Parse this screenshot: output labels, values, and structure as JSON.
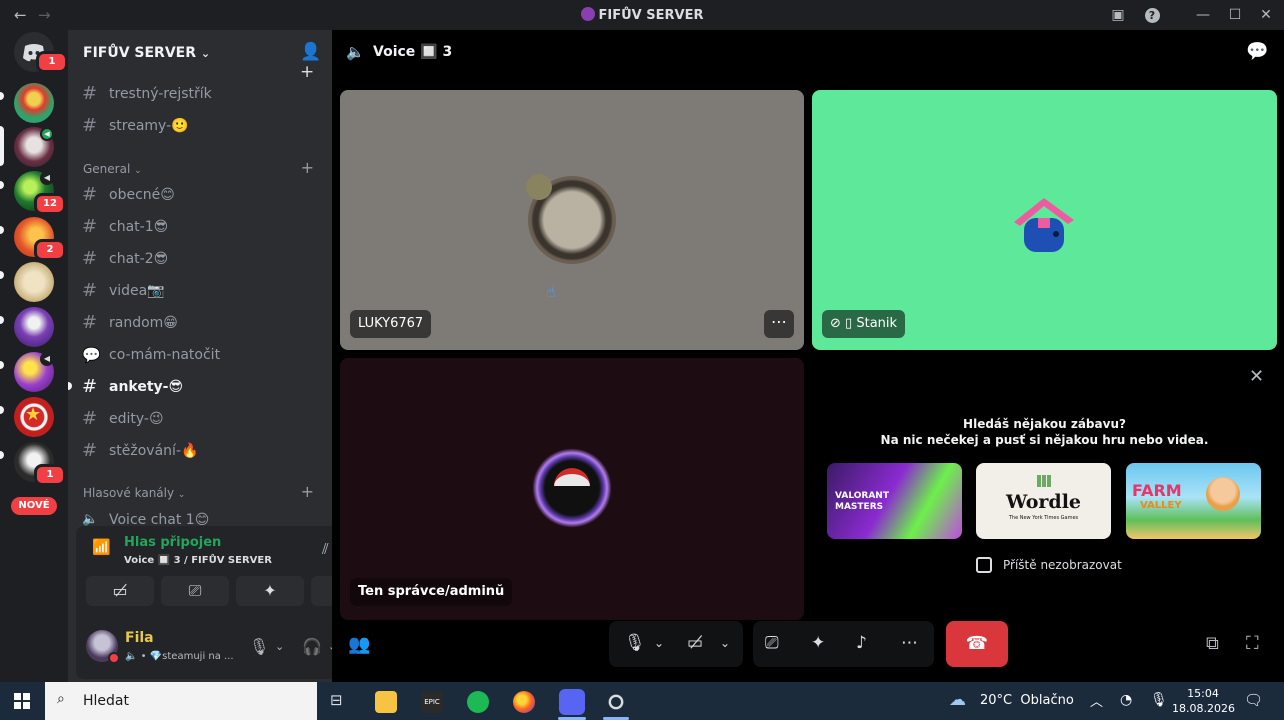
{
  "window": {
    "title": "FIFŮV SERVER",
    "back_icon": "arrow-left-icon",
    "forward_icon": "arrow-right-icon"
  },
  "rail": {
    "home_badge": "1",
    "servers": [
      {
        "name": "server-clown",
        "badge": ""
      },
      {
        "name": "server-fifa",
        "badge": ""
      },
      {
        "name": "server-green",
        "badge": "12"
      },
      {
        "name": "server-orange",
        "badge": "2"
      },
      {
        "name": "server-beige",
        "badge": ""
      },
      {
        "name": "server-purple-girl",
        "badge": ""
      },
      {
        "name": "server-purple-yellow",
        "badge": ""
      },
      {
        "name": "server-red-star",
        "badge": ""
      },
      {
        "name": "server-ace",
        "badge": "1"
      }
    ],
    "new_label": "NOVÉ"
  },
  "sidebar": {
    "server_name": "FIFŮV SERVER",
    "channels_top": [
      {
        "label": "trestný-rejstřík"
      },
      {
        "label": "streamy-🙂"
      }
    ],
    "category_general": "General",
    "channels_general": [
      {
        "label": "obecné😊"
      },
      {
        "label": "chat-1😎"
      },
      {
        "label": "chat-2😎"
      },
      {
        "label": "videa📷"
      },
      {
        "label": "random😁"
      },
      {
        "label": "co-mám-natočit"
      },
      {
        "label": "ankety-😎",
        "active": true
      },
      {
        "label": "edity-😉"
      },
      {
        "label": "stěžování-🔥"
      }
    ],
    "category_voice": "Hlasové kanály",
    "voice_channel": "Voice chat 1😊"
  },
  "voice_panel": {
    "status": "Hlas připojen",
    "channel": "Voice 🔲 3 / FIFŮV SERVER"
  },
  "user_panel": {
    "name": "Fila",
    "status": "💎steamuji na ..."
  },
  "main": {
    "title": "Voice 🔲 3",
    "tiles": [
      {
        "name": "LUKY6767"
      },
      {
        "name": "Stanik"
      },
      {
        "name": "Ten správce/adminŭ"
      }
    ],
    "activity": {
      "line1": "Hledáš nějakou zábavu?",
      "line2": "Na nic nečekej a pusť si nějakou hru nebo videa.",
      "games": [
        {
          "label": "VALORANT MASTERS"
        },
        {
          "label": "Wordle",
          "sub": "The New York Times Games"
        },
        {
          "label": "FARM",
          "sub": "VALLEY"
        }
      ],
      "checkbox_label": "Příště nezobrazovat"
    }
  },
  "taskbar": {
    "search_placeholder": "Hledat",
    "weather": "20°C  Oblačno",
    "time": "15:04",
    "date": "18.08.2026"
  },
  "colors": {
    "green": "#23a55a",
    "red": "#da373c",
    "blurple": "#5865f2",
    "tile_gray": "#7e7b76",
    "tile_green": "#5ee89a",
    "tile_dark": "#1d0d12"
  }
}
